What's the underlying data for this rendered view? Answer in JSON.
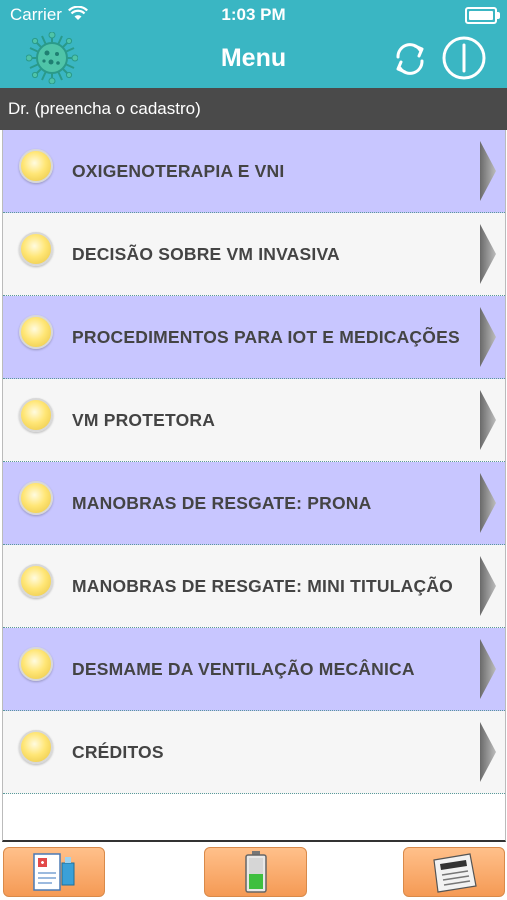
{
  "status": {
    "carrier": "Carrier",
    "time": "1:03 PM"
  },
  "header": {
    "title": "Menu"
  },
  "user": {
    "text": "Dr. (preencha o cadastro)"
  },
  "menu": {
    "items": [
      {
        "label": "OXIGENOTERAPIA E VNI"
      },
      {
        "label": "DECISÃO SOBRE VM INVASIVA"
      },
      {
        "label": "PROCEDIMENTOS PARA IOT E MEDICAÇÕES"
      },
      {
        "label": "VM PROTETORA"
      },
      {
        "label": "MANOBRAS DE RESGATE: PRONA"
      },
      {
        "label": "MANOBRAS DE RESGATE: MINI TITULAÇÃO"
      },
      {
        "label": "DESMAME DA VENTILAÇÃO MECÂNICA"
      },
      {
        "label": "CRÉDITOS"
      }
    ]
  },
  "colors": {
    "header": "#3ab6c3",
    "row_odd": "#c8c6ff",
    "row_even": "#f6f6f6",
    "footer_button": "#f59a55"
  },
  "icons": [
    "virus-icon",
    "refresh-icon",
    "power-icon",
    "chevron-right-icon",
    "medical-chart-icon",
    "battery-icon",
    "newspaper-icon"
  ]
}
